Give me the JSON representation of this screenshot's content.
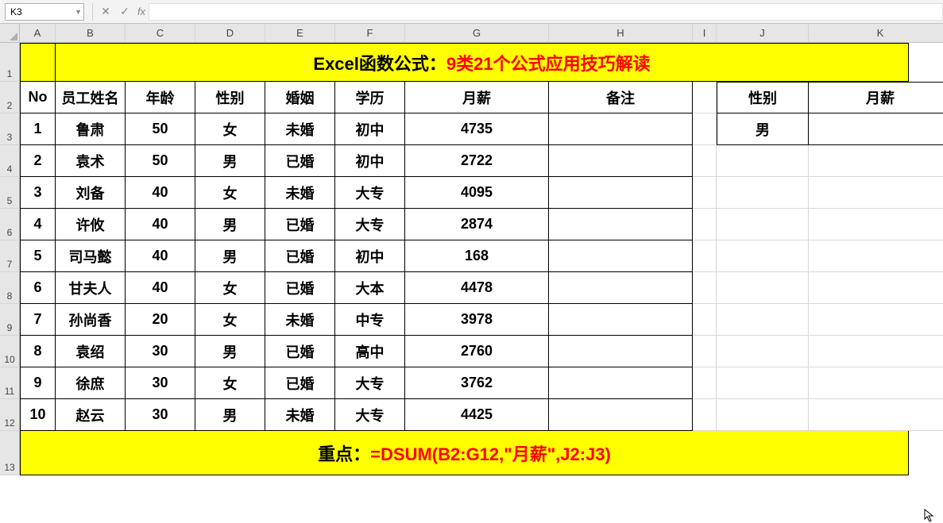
{
  "nameBox": "K3",
  "formula": "",
  "colHeaders": [
    "A",
    "B",
    "C",
    "D",
    "E",
    "F",
    "G",
    "H",
    "I",
    "J",
    "K"
  ],
  "rowHeaders": [
    "1",
    "2",
    "3",
    "4",
    "5",
    "6",
    "7",
    "8",
    "9",
    "10",
    "11",
    "12",
    "13"
  ],
  "title": {
    "black": "Excel函数公式：",
    "red": "9类21个公式应用技巧解读"
  },
  "headers": {
    "no": "No",
    "name": "员工姓名",
    "age": "年龄",
    "sex": "性别",
    "marriage": "婚姻",
    "edu": "学历",
    "salary": "月薪",
    "remark": "备注"
  },
  "criteriaHeaders": {
    "sex": "性别",
    "salary": "月薪"
  },
  "criteriaRow": {
    "sex": "男",
    "salary": ""
  },
  "rows": [
    {
      "no": "1",
      "name": "鲁肃",
      "age": "50",
      "sex": "女",
      "marriage": "未婚",
      "edu": "初中",
      "salary": "4735",
      "remark": ""
    },
    {
      "no": "2",
      "name": "袁术",
      "age": "50",
      "sex": "男",
      "marriage": "已婚",
      "edu": "初中",
      "salary": "2722",
      "remark": ""
    },
    {
      "no": "3",
      "name": "刘备",
      "age": "40",
      "sex": "女",
      "marriage": "未婚",
      "edu": "大专",
      "salary": "4095",
      "remark": ""
    },
    {
      "no": "4",
      "name": "许攸",
      "age": "40",
      "sex": "男",
      "marriage": "已婚",
      "edu": "大专",
      "salary": "2874",
      "remark": ""
    },
    {
      "no": "5",
      "name": "司马懿",
      "age": "40",
      "sex": "男",
      "marriage": "已婚",
      "edu": "初中",
      "salary": "168",
      "remark": ""
    },
    {
      "no": "6",
      "name": "甘夫人",
      "age": "40",
      "sex": "女",
      "marriage": "已婚",
      "edu": "大本",
      "salary": "4478",
      "remark": ""
    },
    {
      "no": "7",
      "name": "孙尚香",
      "age": "20",
      "sex": "女",
      "marriage": "未婚",
      "edu": "中专",
      "salary": "3978",
      "remark": ""
    },
    {
      "no": "8",
      "name": "袁绍",
      "age": "30",
      "sex": "男",
      "marriage": "已婚",
      "edu": "高中",
      "salary": "2760",
      "remark": ""
    },
    {
      "no": "9",
      "name": "徐庶",
      "age": "30",
      "sex": "女",
      "marriage": "已婚",
      "edu": "大专",
      "salary": "3762",
      "remark": ""
    },
    {
      "no": "10",
      "name": "赵云",
      "age": "30",
      "sex": "男",
      "marriage": "未婚",
      "edu": "大专",
      "salary": "4425",
      "remark": ""
    }
  ],
  "keyPoint": {
    "label": "重点：",
    "formula": "=DSUM(B2:G12,\"月薪\",J2:J3)"
  },
  "chart_data": {
    "type": "table",
    "title": "Excel函数公式：9类21个公式应用技巧解读",
    "columns": [
      "No",
      "员工姓名",
      "年龄",
      "性别",
      "婚姻",
      "学历",
      "月薪",
      "备注"
    ],
    "data": [
      [
        1,
        "鲁肃",
        50,
        "女",
        "未婚",
        "初中",
        4735,
        ""
      ],
      [
        2,
        "袁术",
        50,
        "男",
        "已婚",
        "初中",
        2722,
        ""
      ],
      [
        3,
        "刘备",
        40,
        "女",
        "未婚",
        "大专",
        4095,
        ""
      ],
      [
        4,
        "许攸",
        40,
        "男",
        "已婚",
        "大专",
        2874,
        ""
      ],
      [
        5,
        "司马懿",
        40,
        "男",
        "已婚",
        "初中",
        168,
        ""
      ],
      [
        6,
        "甘夫人",
        40,
        "女",
        "已婚",
        "大本",
        4478,
        ""
      ],
      [
        7,
        "孙尚香",
        20,
        "女",
        "未婚",
        "中专",
        3978,
        ""
      ],
      [
        8,
        "袁绍",
        30,
        "男",
        "已婚",
        "高中",
        2760,
        ""
      ],
      [
        9,
        "徐庶",
        30,
        "女",
        "已婚",
        "大专",
        3762,
        ""
      ],
      [
        10,
        "赵云",
        30,
        "男",
        "未婚",
        "大专",
        4425,
        ""
      ]
    ],
    "criteria": {
      "性别": "男"
    },
    "formula": "=DSUM(B2:G12,\"月薪\",J2:J3)"
  }
}
